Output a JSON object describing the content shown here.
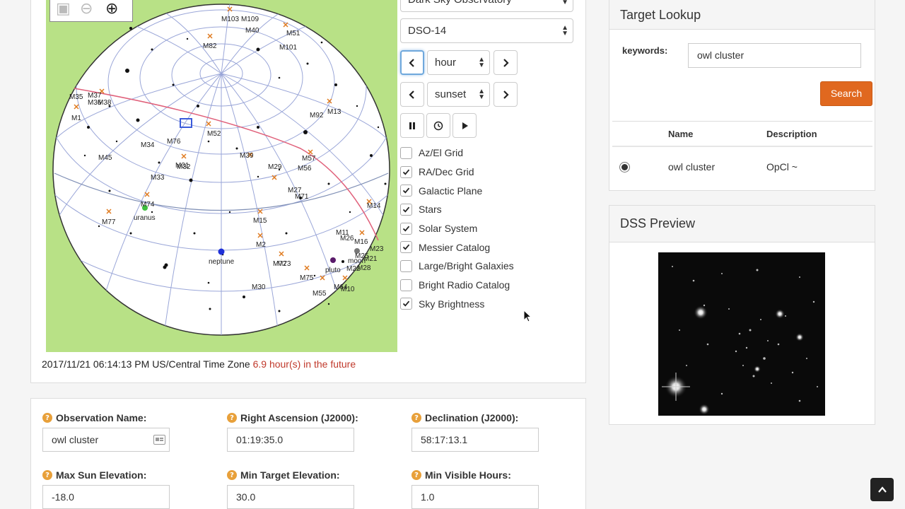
{
  "sky": {
    "observatory_select": "Dark Sky Observatory",
    "dso_select": "DSO-14",
    "step_select": "hour",
    "event_select": "sunset",
    "labels": {
      "m103": "M103",
      "m109": "M109",
      "m40": "M40",
      "m51": "M51",
      "m82": "M82",
      "m101": "M101",
      "m35": "M35",
      "m37": "M37",
      "m36": "M36",
      "m38": "M38",
      "m1": "M1",
      "m92": "M92",
      "m13": "M13",
      "m52": "M52",
      "m34": "M34",
      "m76": "M76",
      "m45": "M45",
      "m33": "M33",
      "m31": "M31",
      "m32": "M32",
      "m39": "M39",
      "m29": "M29",
      "m57": "M57",
      "m56": "M56",
      "m27": "M27",
      "m71": "M71",
      "m74": "M74",
      "m14": "M14",
      "m77": "M77",
      "m15": "M15",
      "m11": "M11",
      "m26": "M26",
      "m2": "M2",
      "m72": "M72",
      "m73": "M73",
      "m75": "M75",
      "m30": "M30",
      "m55": "M55",
      "m64": "M64",
      "m10": "M10",
      "m16": "M16",
      "m23": "M23",
      "m21": "M21",
      "m25": "M25",
      "m28": "M28",
      "m22": "M22",
      "uranus": "uranus",
      "neptune": "neptune",
      "pluto": "pluto",
      "moon": "moon"
    },
    "options": [
      {
        "label": "Az/El Grid",
        "checked": false
      },
      {
        "label": "RA/Dec Grid",
        "checked": true
      },
      {
        "label": "Galactic Plane",
        "checked": true
      },
      {
        "label": "Stars",
        "checked": true
      },
      {
        "label": "Solar System",
        "checked": true
      },
      {
        "label": "Messier Catalog",
        "checked": true
      },
      {
        "label": "Large/Bright Galaxies",
        "checked": false
      },
      {
        "label": "Bright Radio Catalog",
        "checked": false
      },
      {
        "label": "Sky Brightness",
        "checked": true
      }
    ],
    "datetime": "2017/11/21 06:14:13 PM US/Central Time Zone",
    "future_note": "6.9 hour(s) in the future",
    "colors": {
      "background": "#b8e186",
      "galactic_plane": "#e0607a",
      "grid": "#9aa6d8"
    }
  },
  "observation": {
    "name_label": "Observation Name:",
    "name_value": "owl cluster",
    "ra_label": "Right Ascension (J2000):",
    "ra_value": "01:19:35.0",
    "dec_label": "Declination (J2000):",
    "dec_value": "58:17:13.1",
    "max_sun_label": "Max Sun Elevation:",
    "max_sun_value": "-18.0",
    "min_target_label": "Min Target Elevation:",
    "min_target_value": "30.0",
    "min_hours_label": "Min Visible Hours:",
    "min_hours_value": "1.0"
  },
  "target_lookup": {
    "title": "Target Lookup",
    "keywords_label": "keywords:",
    "keywords_value": "owl cluster",
    "search_label": "Search",
    "columns": [
      "Name",
      "Description"
    ],
    "results": [
      {
        "name": "owl cluster",
        "description": "OpCl ~",
        "selected": true
      }
    ],
    "accent": "#e0681f"
  },
  "dss": {
    "title": "DSS Preview"
  }
}
